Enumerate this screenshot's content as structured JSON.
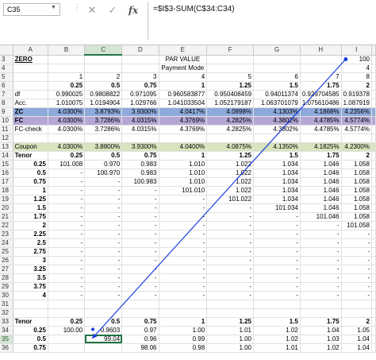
{
  "formula_bar": {
    "name_box": "C35",
    "cancel_icon": "✕",
    "enter_icon": "✓",
    "fx_label": "fx",
    "formula": "=$I$3-SUM(C$34:C34)"
  },
  "columns": [
    "A",
    "B",
    "C",
    "D",
    "E",
    "F",
    "G",
    "H",
    "I"
  ],
  "selected_column": "C",
  "selected_row": "35",
  "rows": [
    {
      "num": "3",
      "cells": [
        "ZERO",
        "",
        "",
        "",
        "PAR VALUE",
        "",
        "",
        "",
        "100"
      ]
    },
    {
      "num": "4",
      "cells": [
        "",
        "",
        "",
        "",
        "Payment Mode",
        "",
        "",
        "",
        "4"
      ]
    },
    {
      "num": "5",
      "cells": [
        "",
        "1",
        "2",
        "3",
        "4",
        "5",
        "6",
        "7",
        "8"
      ]
    },
    {
      "num": "6",
      "cells": [
        "",
        "0.25",
        "0.5",
        "0.75",
        "1",
        "1.25",
        "1.5",
        "1.75",
        "2"
      ]
    },
    {
      "num": "7",
      "cells": [
        "df",
        "0.990025",
        "0.9808822",
        "0.971095",
        "0.960583877",
        "0.950408459",
        "0.94011374",
        "0.929704585",
        "0.919378"
      ]
    },
    {
      "num": "8",
      "cells": [
        "Acc.",
        "1.010075",
        "1.0194904",
        "1.029766",
        "1.041033504",
        "1.052179187",
        "1.063701079",
        "1.075610486",
        "1.087919"
      ]
    },
    {
      "num": "9",
      "cells": [
        "ZC",
        "4.0300%",
        "3.8793%",
        "3.9300%",
        "4.0417%",
        "4.0898%",
        "4.1303%",
        "4.1868%",
        "4.2356%"
      ]
    },
    {
      "num": "10",
      "cells": [
        "FC",
        "4.0300%",
        "3.7286%",
        "4.0315%",
        "4.3769%",
        "4.2825%",
        "4.3802%",
        "4.4785%",
        "4.5774%"
      ]
    },
    {
      "num": "11",
      "cells": [
        "FC-check",
        "4.0300%",
        "3.7286%",
        "4.0315%",
        "4.3769%",
        "4.2825%",
        "4.3802%",
        "4.4785%",
        "4.5774%"
      ]
    },
    {
      "num": "12",
      "cells": [
        "",
        "",
        "",
        "",
        "",
        "",
        "",
        "",
        ""
      ]
    },
    {
      "num": "13",
      "cells": [
        "Coupon",
        "4.0300%",
        "3.8800%",
        "3.9300%",
        "4.0400%",
        "4.0875%",
        "4.1350%",
        "4.1825%",
        "4.2300%"
      ]
    },
    {
      "num": "14",
      "cells": [
        "Tenor",
        "0.25",
        "0.5",
        "0.75",
        "1",
        "1.25",
        "1.5",
        "1.75",
        "2"
      ]
    },
    {
      "num": "15",
      "cells": [
        "0.25",
        "101.008",
        "0.970",
        "0.983",
        "1.010",
        "1.022",
        "1.034",
        "1.046",
        "1.058"
      ]
    },
    {
      "num": "16",
      "cells": [
        "0.5",
        "-",
        "100.970",
        "0.983",
        "1.010",
        "1.022",
        "1.034",
        "1.046",
        "1.058"
      ]
    },
    {
      "num": "17",
      "cells": [
        "0.75",
        "-",
        "-",
        "100.983",
        "1.010",
        "1.022",
        "1.034",
        "1.046",
        "1.058"
      ]
    },
    {
      "num": "18",
      "cells": [
        "1",
        "-",
        "-",
        "-",
        "101.010",
        "1.022",
        "1.034",
        "1.046",
        "1.058"
      ]
    },
    {
      "num": "19",
      "cells": [
        "1.25",
        "-",
        "-",
        "-",
        "-",
        "101.022",
        "1.034",
        "1.046",
        "1.058"
      ]
    },
    {
      "num": "20",
      "cells": [
        "1.5",
        "-",
        "-",
        "-",
        "-",
        "-",
        "101.034",
        "1.046",
        "1.058"
      ]
    },
    {
      "num": "21",
      "cells": [
        "1.75",
        "-",
        "-",
        "-",
        "-",
        "-",
        "-",
        "101.046",
        "1.058"
      ]
    },
    {
      "num": "22",
      "cells": [
        "2",
        "-",
        "-",
        "-",
        "-",
        "-",
        "-",
        "-",
        "101.058"
      ]
    },
    {
      "num": "23",
      "cells": [
        "2.25",
        "-",
        "-",
        "-",
        "-",
        "-",
        "-",
        "-",
        "-"
      ]
    },
    {
      "num": "24",
      "cells": [
        "2.5",
        "-",
        "-",
        "-",
        "-",
        "-",
        "-",
        "-",
        "-"
      ]
    },
    {
      "num": "25",
      "cells": [
        "2.75",
        "-",
        "-",
        "-",
        "-",
        "-",
        "-",
        "-",
        "-"
      ]
    },
    {
      "num": "26",
      "cells": [
        "3",
        "-",
        "-",
        "-",
        "-",
        "-",
        "-",
        "-",
        "-"
      ]
    },
    {
      "num": "27",
      "cells": [
        "3.25",
        "-",
        "-",
        "-",
        "-",
        "-",
        "-",
        "-",
        "-"
      ]
    },
    {
      "num": "28",
      "cells": [
        "3.5",
        "-",
        "-",
        "-",
        "-",
        "-",
        "-",
        "-",
        "-"
      ]
    },
    {
      "num": "29",
      "cells": [
        "3.75",
        "-",
        "-",
        "-",
        "-",
        "-",
        "-",
        "-",
        "-"
      ]
    },
    {
      "num": "30",
      "cells": [
        "4",
        "-",
        "-",
        "-",
        "-",
        "-",
        "-",
        "-",
        "-"
      ]
    },
    {
      "num": "31",
      "cells": [
        "",
        "",
        "",
        "",
        "",
        "",
        "",
        "",
        ""
      ]
    },
    {
      "num": "32",
      "cells": [
        "",
        "",
        "",
        "",
        "",
        "",
        "",
        "",
        ""
      ]
    },
    {
      "num": "33",
      "cells": [
        "Tenor",
        "0.25",
        "0.5",
        "0.75",
        "1",
        "1.25",
        "1.5",
        "1.75",
        "2"
      ]
    },
    {
      "num": "34",
      "cells": [
        "0.25",
        "100.00",
        "0.9603",
        "0.97",
        "1.00",
        "1.01",
        "1.02",
        "1.04",
        "1.05"
      ]
    },
    {
      "num": "35",
      "cells": [
        "0.5",
        "",
        "99.04",
        "0.96",
        "0.99",
        "1.00",
        "1.02",
        "1.03",
        "1.04"
      ]
    },
    {
      "num": "36",
      "cells": [
        "0.75",
        "",
        "",
        "98.06",
        "0.98",
        "1.00",
        "1.01",
        "1.02",
        "1.04"
      ]
    }
  ],
  "colors": {
    "zc_row": "#8eaadb",
    "fc_row": "#b4a7d6",
    "coupon_row": "#d7e4bd",
    "selection": "#217346",
    "tracer_arrow": "#1a3fe0"
  }
}
